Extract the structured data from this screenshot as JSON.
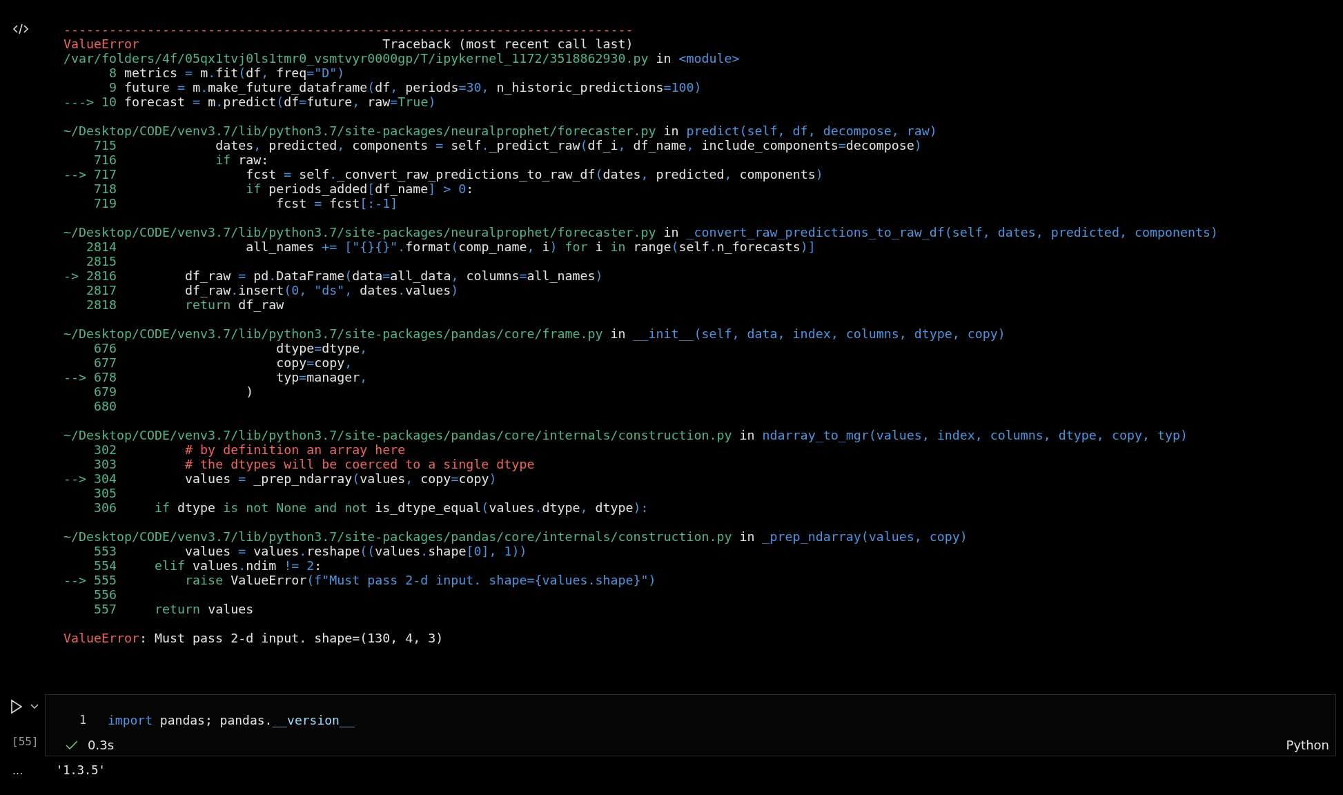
{
  "traceback": {
    "blocks": [
      {
        "lines": [
          [
            {
              "text": "---------------------------------------------------------------------------",
              "kind": "error"
            }
          ],
          [
            {
              "text": "ValueError",
              "kind": "error"
            },
            {
              "text": "                                Traceback (most recent call last)",
              "kind": "plain"
            }
          ],
          [
            {
              "text": "/var/folders/4f/05qx1tvj0ls1tmr0_vsmtvyr0000gp/T/ipykernel_1172/3518862930.py",
              "kind": "path"
            },
            {
              "text": " in ",
              "kind": "plain"
            },
            {
              "text": "<module>",
              "kind": "token"
            }
          ],
          [
            {
              "text": "      8",
              "kind": "lineno"
            },
            {
              "text": " metrics ",
              "kind": "plain"
            },
            {
              "text": "=",
              "kind": "token"
            },
            {
              "text": " m",
              "kind": "plain"
            },
            {
              "text": ".",
              "kind": "token"
            },
            {
              "text": "fit",
              "kind": "plain"
            },
            {
              "text": "(",
              "kind": "token"
            },
            {
              "text": "df",
              "kind": "plain"
            },
            {
              "text": ", ",
              "kind": "token"
            },
            {
              "text": "freq",
              "kind": "plain"
            },
            {
              "text": "=",
              "kind": "token"
            },
            {
              "text": "\"D\"",
              "kind": "token"
            },
            {
              "text": ")",
              "kind": "token"
            }
          ],
          [
            {
              "text": "      9",
              "kind": "lineno"
            },
            {
              "text": " future ",
              "kind": "plain"
            },
            {
              "text": "=",
              "kind": "token"
            },
            {
              "text": " m",
              "kind": "plain"
            },
            {
              "text": ".",
              "kind": "token"
            },
            {
              "text": "make_future_dataframe",
              "kind": "plain"
            },
            {
              "text": "(",
              "kind": "token"
            },
            {
              "text": "df",
              "kind": "plain"
            },
            {
              "text": ", ",
              "kind": "token"
            },
            {
              "text": "periods",
              "kind": "plain"
            },
            {
              "text": "=30, ",
              "kind": "token"
            },
            {
              "text": "n_historic_predictions",
              "kind": "plain"
            },
            {
              "text": "=100)",
              "kind": "token"
            }
          ],
          [
            {
              "text": "---> 10",
              "kind": "lineno"
            },
            {
              "text": " forecast ",
              "kind": "plain"
            },
            {
              "text": "=",
              "kind": "token"
            },
            {
              "text": " m",
              "kind": "plain"
            },
            {
              "text": ".",
              "kind": "token"
            },
            {
              "text": "predict",
              "kind": "plain"
            },
            {
              "text": "(",
              "kind": "token"
            },
            {
              "text": "df",
              "kind": "plain"
            },
            {
              "text": "=",
              "kind": "token"
            },
            {
              "text": "future",
              "kind": "plain"
            },
            {
              "text": ", ",
              "kind": "token"
            },
            {
              "text": "raw",
              "kind": "plain"
            },
            {
              "text": "=",
              "kind": "token"
            },
            {
              "text": "True",
              "kind": "keyword"
            },
            {
              "text": ")",
              "kind": "token"
            }
          ]
        ]
      },
      {
        "lines": [
          [
            {
              "text": "~/Desktop/CODE/venv3.7/lib/python3.7/site-packages/neuralprophet/forecaster.py",
              "kind": "path"
            },
            {
              "text": " in ",
              "kind": "plain"
            },
            {
              "text": "predict(self, df, decompose, raw)",
              "kind": "token"
            }
          ],
          [
            {
              "text": "    715",
              "kind": "lineno"
            },
            {
              "text": "             dates",
              "kind": "plain"
            },
            {
              "text": ", ",
              "kind": "token"
            },
            {
              "text": "predicted",
              "kind": "plain"
            },
            {
              "text": ", ",
              "kind": "token"
            },
            {
              "text": "components ",
              "kind": "plain"
            },
            {
              "text": "=",
              "kind": "token"
            },
            {
              "text": " self",
              "kind": "plain"
            },
            {
              "text": ".",
              "kind": "token"
            },
            {
              "text": "_predict_raw",
              "kind": "plain"
            },
            {
              "text": "(",
              "kind": "token"
            },
            {
              "text": "df_i",
              "kind": "plain"
            },
            {
              "text": ", ",
              "kind": "token"
            },
            {
              "text": "df_name",
              "kind": "plain"
            },
            {
              "text": ", ",
              "kind": "token"
            },
            {
              "text": "include_components",
              "kind": "plain"
            },
            {
              "text": "=",
              "kind": "token"
            },
            {
              "text": "decompose",
              "kind": "plain"
            },
            {
              "text": ")",
              "kind": "token"
            }
          ],
          [
            {
              "text": "    716",
              "kind": "lineno"
            },
            {
              "text": "             if",
              "kind": "keyword"
            },
            {
              "text": " raw:",
              "kind": "plain"
            }
          ],
          [
            {
              "text": "--> 717",
              "kind": "lineno"
            },
            {
              "text": "                 fcst ",
              "kind": "plain"
            },
            {
              "text": "=",
              "kind": "token"
            },
            {
              "text": " self",
              "kind": "plain"
            },
            {
              "text": ".",
              "kind": "token"
            },
            {
              "text": "_convert_raw_predictions_to_raw_df",
              "kind": "plain"
            },
            {
              "text": "(",
              "kind": "token"
            },
            {
              "text": "dates",
              "kind": "plain"
            },
            {
              "text": ", ",
              "kind": "token"
            },
            {
              "text": "predicted",
              "kind": "plain"
            },
            {
              "text": ", ",
              "kind": "token"
            },
            {
              "text": "components",
              "kind": "plain"
            },
            {
              "text": ")",
              "kind": "token"
            }
          ],
          [
            {
              "text": "    718",
              "kind": "lineno"
            },
            {
              "text": "                 if",
              "kind": "keyword"
            },
            {
              "text": " periods_added",
              "kind": "plain"
            },
            {
              "text": "[",
              "kind": "token"
            },
            {
              "text": "df_name",
              "kind": "plain"
            },
            {
              "text": "] > 0",
              "kind": "token"
            },
            {
              "text": ":",
              "kind": "plain"
            }
          ],
          [
            {
              "text": "    719",
              "kind": "lineno"
            },
            {
              "text": "                     fcst ",
              "kind": "plain"
            },
            {
              "text": "=",
              "kind": "token"
            },
            {
              "text": " fcst",
              "kind": "plain"
            },
            {
              "text": "[:-1]",
              "kind": "token"
            }
          ]
        ]
      },
      {
        "lines": [
          [
            {
              "text": "~/Desktop/CODE/venv3.7/lib/python3.7/site-packages/neuralprophet/forecaster.py",
              "kind": "path"
            },
            {
              "text": " in ",
              "kind": "plain"
            },
            {
              "text": "_convert_raw_predictions_to_raw_df(self, dates, predicted, components)",
              "kind": "token"
            }
          ],
          [
            {
              "text": "   2814",
              "kind": "lineno"
            },
            {
              "text": "                 all_names ",
              "kind": "plain"
            },
            {
              "text": "+= [\"{}{}\".",
              "kind": "token"
            },
            {
              "text": "format",
              "kind": "plain"
            },
            {
              "text": "(",
              "kind": "token"
            },
            {
              "text": "comp_name",
              "kind": "plain"
            },
            {
              "text": ", ",
              "kind": "token"
            },
            {
              "text": "i",
              "kind": "plain"
            },
            {
              "text": ") ",
              "kind": "token"
            },
            {
              "text": "for",
              "kind": "keyword"
            },
            {
              "text": " i ",
              "kind": "plain"
            },
            {
              "text": "in",
              "kind": "keyword"
            },
            {
              "text": " range",
              "kind": "plain"
            },
            {
              "text": "(",
              "kind": "token"
            },
            {
              "text": "self",
              "kind": "plain"
            },
            {
              "text": ".",
              "kind": "token"
            },
            {
              "text": "n_forecasts",
              "kind": "plain"
            },
            {
              "text": ")]",
              "kind": "token"
            }
          ],
          [
            {
              "text": "   2815",
              "kind": "lineno"
            }
          ],
          [
            {
              "text": "-> 2816",
              "kind": "lineno"
            },
            {
              "text": "         df_raw ",
              "kind": "plain"
            },
            {
              "text": "=",
              "kind": "token"
            },
            {
              "text": " pd",
              "kind": "plain"
            },
            {
              "text": ".",
              "kind": "token"
            },
            {
              "text": "DataFrame",
              "kind": "plain"
            },
            {
              "text": "(",
              "kind": "token"
            },
            {
              "text": "data",
              "kind": "plain"
            },
            {
              "text": "=",
              "kind": "token"
            },
            {
              "text": "all_data",
              "kind": "plain"
            },
            {
              "text": ", ",
              "kind": "token"
            },
            {
              "text": "columns",
              "kind": "plain"
            },
            {
              "text": "=",
              "kind": "token"
            },
            {
              "text": "all_names",
              "kind": "plain"
            },
            {
              "text": ")",
              "kind": "token"
            }
          ],
          [
            {
              "text": "   2817",
              "kind": "lineno"
            },
            {
              "text": "         df_raw",
              "kind": "plain"
            },
            {
              "text": ".",
              "kind": "token"
            },
            {
              "text": "insert",
              "kind": "plain"
            },
            {
              "text": "(0, \"ds\", ",
              "kind": "token"
            },
            {
              "text": "dates",
              "kind": "plain"
            },
            {
              "text": ".",
              "kind": "token"
            },
            {
              "text": "values",
              "kind": "plain"
            },
            {
              "text": ")",
              "kind": "token"
            }
          ],
          [
            {
              "text": "   2818",
              "kind": "lineno"
            },
            {
              "text": "         return",
              "kind": "keyword"
            },
            {
              "text": " df_raw",
              "kind": "plain"
            }
          ]
        ]
      },
      {
        "lines": [
          [
            {
              "text": "~/Desktop/CODE/venv3.7/lib/python3.7/site-packages/pandas/core/frame.py",
              "kind": "path"
            },
            {
              "text": " in ",
              "kind": "plain"
            },
            {
              "text": "__init__(self, data, index, columns, dtype, copy)",
              "kind": "token"
            }
          ],
          [
            {
              "text": "    676",
              "kind": "lineno"
            },
            {
              "text": "                     dtype",
              "kind": "plain"
            },
            {
              "text": "=",
              "kind": "token"
            },
            {
              "text": "dtype",
              "kind": "plain"
            },
            {
              "text": ",",
              "kind": "token"
            }
          ],
          [
            {
              "text": "    677",
              "kind": "lineno"
            },
            {
              "text": "                     copy",
              "kind": "plain"
            },
            {
              "text": "=",
              "kind": "token"
            },
            {
              "text": "copy",
              "kind": "plain"
            },
            {
              "text": ",",
              "kind": "token"
            }
          ],
          [
            {
              "text": "--> 678",
              "kind": "lineno"
            },
            {
              "text": "                     typ",
              "kind": "plain"
            },
            {
              "text": "=",
              "kind": "token"
            },
            {
              "text": "manager",
              "kind": "plain"
            },
            {
              "text": ",",
              "kind": "token"
            }
          ],
          [
            {
              "text": "    679",
              "kind": "lineno"
            },
            {
              "text": "                 )",
              "kind": "plain"
            }
          ],
          [
            {
              "text": "    680",
              "kind": "lineno"
            }
          ]
        ]
      },
      {
        "lines": [
          [
            {
              "text": "~/Desktop/CODE/venv3.7/lib/python3.7/site-packages/pandas/core/internals/construction.py",
              "kind": "path"
            },
            {
              "text": " in ",
              "kind": "plain"
            },
            {
              "text": "ndarray_to_mgr(values, index, columns, dtype, copy, typ)",
              "kind": "token"
            }
          ],
          [
            {
              "text": "    302",
              "kind": "lineno"
            },
            {
              "text": "         # by definition an array here",
              "kind": "comment"
            }
          ],
          [
            {
              "text": "    303",
              "kind": "lineno"
            },
            {
              "text": "         # the dtypes will be coerced to a single dtype",
              "kind": "comment"
            }
          ],
          [
            {
              "text": "--> 304",
              "kind": "lineno"
            },
            {
              "text": "         values ",
              "kind": "plain"
            },
            {
              "text": "=",
              "kind": "token"
            },
            {
              "text": " _prep_ndarray",
              "kind": "plain"
            },
            {
              "text": "(",
              "kind": "token"
            },
            {
              "text": "values",
              "kind": "plain"
            },
            {
              "text": ", ",
              "kind": "token"
            },
            {
              "text": "copy",
              "kind": "plain"
            },
            {
              "text": "=",
              "kind": "token"
            },
            {
              "text": "copy",
              "kind": "plain"
            },
            {
              "text": ")",
              "kind": "token"
            }
          ],
          [
            {
              "text": "    305",
              "kind": "lineno"
            }
          ],
          [
            {
              "text": "    306",
              "kind": "lineno"
            },
            {
              "text": "     if",
              "kind": "keyword"
            },
            {
              "text": " dtype ",
              "kind": "plain"
            },
            {
              "text": "is not None and not",
              "kind": "keyword"
            },
            {
              "text": " is_dtype_equal",
              "kind": "plain"
            },
            {
              "text": "(",
              "kind": "token"
            },
            {
              "text": "values",
              "kind": "plain"
            },
            {
              "text": ".",
              "kind": "token"
            },
            {
              "text": "dtype",
              "kind": "plain"
            },
            {
              "text": ", ",
              "kind": "token"
            },
            {
              "text": "dtype",
              "kind": "plain"
            },
            {
              "text": "):",
              "kind": "token"
            }
          ]
        ]
      },
      {
        "lines": [
          [
            {
              "text": "~/Desktop/CODE/venv3.7/lib/python3.7/site-packages/pandas/core/internals/construction.py",
              "kind": "path"
            },
            {
              "text": " in ",
              "kind": "plain"
            },
            {
              "text": "_prep_ndarray(values, copy)",
              "kind": "token"
            }
          ],
          [
            {
              "text": "    553",
              "kind": "lineno"
            },
            {
              "text": "         values ",
              "kind": "plain"
            },
            {
              "text": "=",
              "kind": "token"
            },
            {
              "text": " values",
              "kind": "plain"
            },
            {
              "text": ".",
              "kind": "token"
            },
            {
              "text": "reshape",
              "kind": "plain"
            },
            {
              "text": "((",
              "kind": "token"
            },
            {
              "text": "values",
              "kind": "plain"
            },
            {
              "text": ".",
              "kind": "token"
            },
            {
              "text": "shape",
              "kind": "plain"
            },
            {
              "text": "[0], 1))",
              "kind": "token"
            }
          ],
          [
            {
              "text": "    554",
              "kind": "lineno"
            },
            {
              "text": "     elif",
              "kind": "keyword"
            },
            {
              "text": " values",
              "kind": "plain"
            },
            {
              "text": ".",
              "kind": "token"
            },
            {
              "text": "ndim ",
              "kind": "plain"
            },
            {
              "text": "!= 2",
              "kind": "token"
            },
            {
              "text": ":",
              "kind": "plain"
            }
          ],
          [
            {
              "text": "--> 555",
              "kind": "lineno"
            },
            {
              "text": "         raise",
              "kind": "keyword"
            },
            {
              "text": " ValueError",
              "kind": "plain"
            },
            {
              "text": "(f\"Must pass 2-d input. shape={values.shape}\")",
              "kind": "token"
            }
          ],
          [
            {
              "text": "    556",
              "kind": "lineno"
            }
          ],
          [
            {
              "text": "    557",
              "kind": "lineno"
            },
            {
              "text": "     return",
              "kind": "keyword"
            },
            {
              "text": " values",
              "kind": "plain"
            }
          ]
        ]
      },
      {
        "lines": [
          [
            {
              "text": "ValueError",
              "kind": "error"
            },
            {
              "text": ": Must pass 2-d input. shape=(130, 4, 3)",
              "kind": "plain"
            }
          ]
        ]
      }
    ]
  },
  "cell": {
    "execution_count": "[55]",
    "line_number": "1",
    "code": [
      {
        "text": "import",
        "kind": "keyword"
      },
      {
        "text": " pandas; pandas.",
        "kind": "plain"
      },
      {
        "text": "__version__",
        "kind": "attribute"
      }
    ],
    "succeeded": true,
    "duration": "0.3s",
    "language": "Python"
  },
  "output": {
    "prompt": "...",
    "value": "'1.3.5'"
  }
}
